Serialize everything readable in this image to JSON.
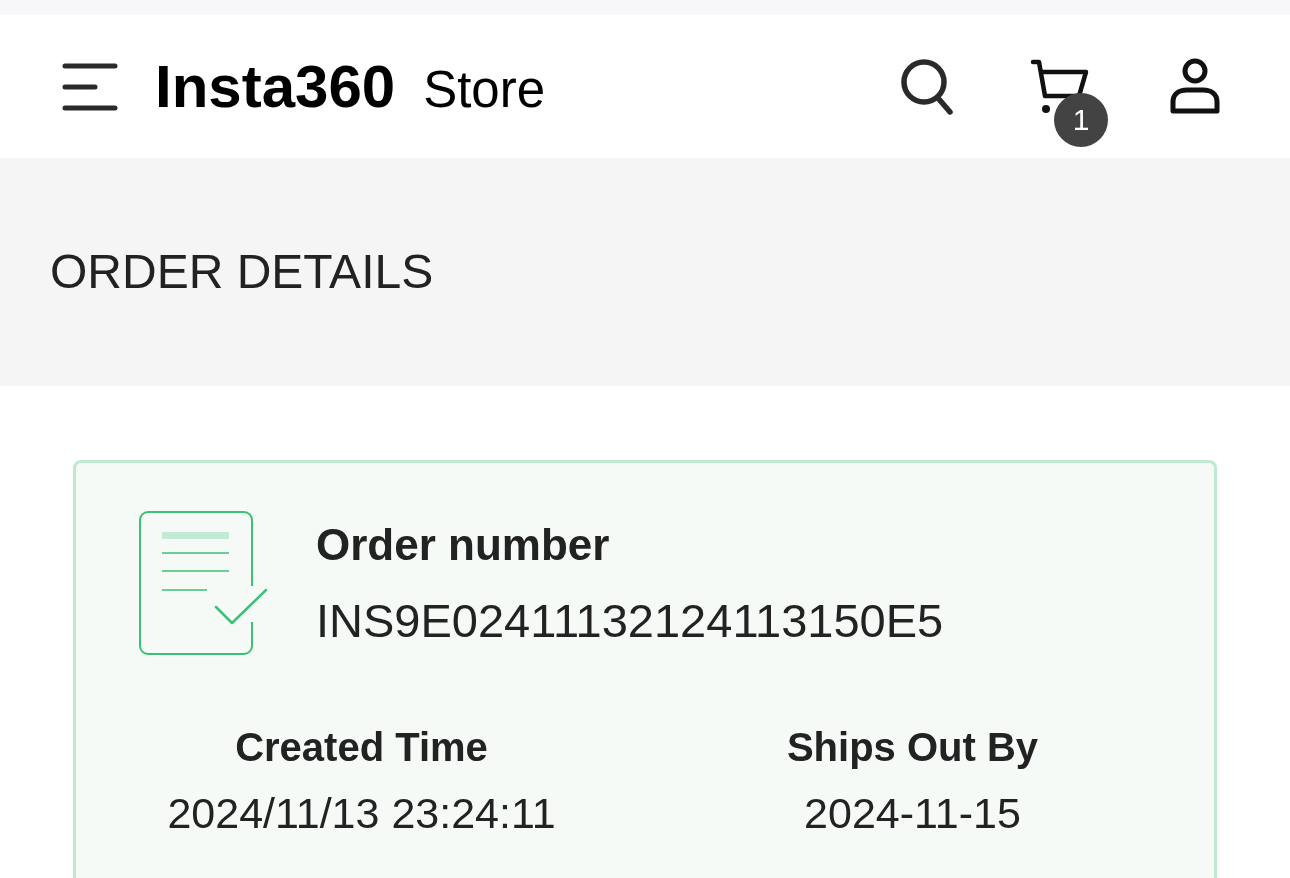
{
  "header": {
    "logo": "Insta360",
    "logo_suffix": "Store",
    "cart_count": "1"
  },
  "page_title": "ORDER DETAILS",
  "order_card": {
    "order_number_label": "Order number",
    "order_number": "INS9E02411132124113150E5",
    "details": [
      {
        "label": "Created Time",
        "value": "2024/11/13 23:24:11"
      },
      {
        "label": "Ships Out By",
        "value": "2024-11-15"
      }
    ]
  }
}
